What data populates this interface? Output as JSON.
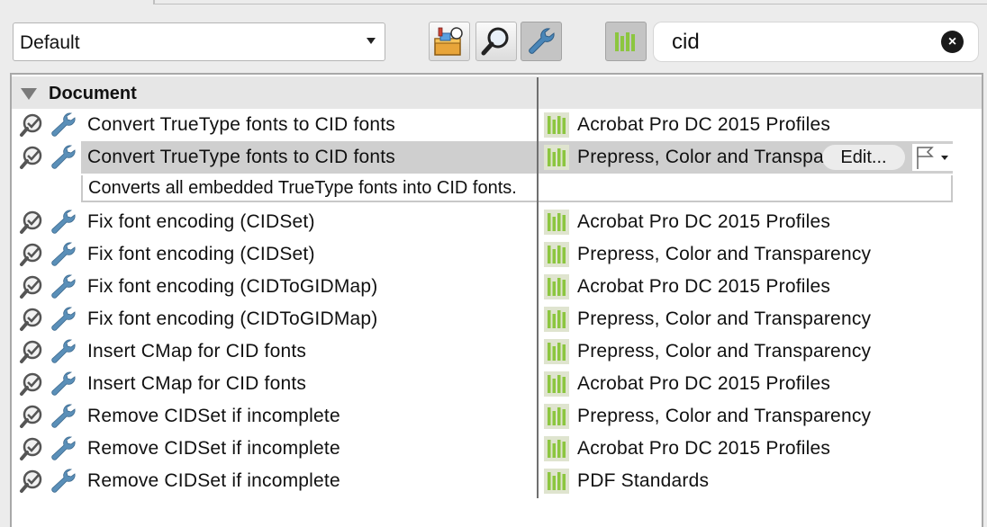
{
  "toolbar": {
    "profile_select": "Default",
    "search_value": "cid",
    "search_clear_symbol": "×"
  },
  "group": {
    "title": "Document"
  },
  "rows": [
    {
      "name": "Convert TrueType fonts to CID fonts",
      "profile": "Acrobat Pro DC 2015 Profiles"
    },
    {
      "name": "Convert TrueType fonts to CID fonts",
      "profile": "Prepress, Color and Transparency",
      "selected": true
    },
    {
      "name": "Fix font encoding (CIDSet)",
      "profile": "Acrobat Pro DC 2015 Profiles"
    },
    {
      "name": "Fix font encoding (CIDSet)",
      "profile": "Prepress, Color and Transparency"
    },
    {
      "name": "Fix font encoding (CIDToGIDMap)",
      "profile": "Acrobat Pro DC 2015 Profiles"
    },
    {
      "name": "Fix font encoding (CIDToGIDMap)",
      "profile": "Prepress, Color and Transparency"
    },
    {
      "name": "Insert CMap for CID fonts",
      "profile": "Prepress, Color and Transparency"
    },
    {
      "name": "Insert CMap for CID fonts",
      "profile": "Acrobat Pro DC 2015 Profiles"
    },
    {
      "name": "Remove CIDSet if incomplete",
      "profile": "Prepress, Color and Transparency"
    },
    {
      "name": "Remove CIDSet if incomplete",
      "profile": "Acrobat Pro DC 2015 Profiles"
    },
    {
      "name": "Remove CIDSet if incomplete",
      "profile": "PDF Standards"
    }
  ],
  "selected_row": {
    "edit_label": "Edit...",
    "description": "Converts all embedded TrueType fonts into CID fonts."
  },
  "colors": {
    "profile_bars": "#8cc63f",
    "selection": "#cfcfcf",
    "fixup_icon": "#5a8fb8"
  }
}
